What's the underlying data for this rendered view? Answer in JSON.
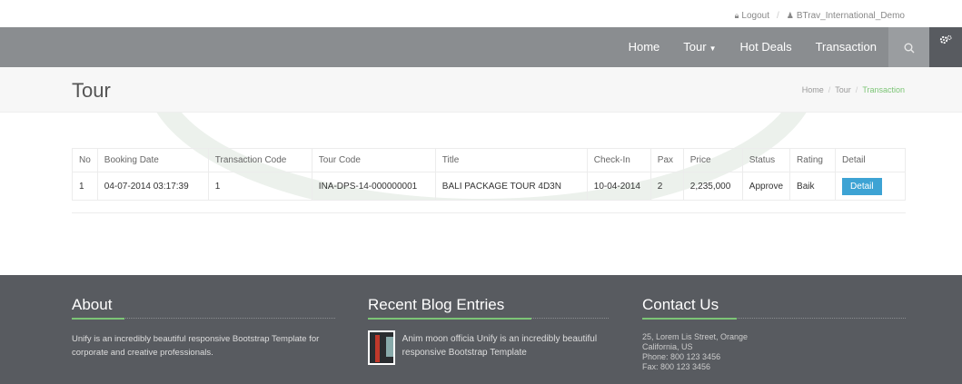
{
  "topbar": {
    "logout_label": "Logout",
    "user_label": "BTrav_International_Demo"
  },
  "nav": {
    "items": [
      {
        "label": "Home"
      },
      {
        "label": "Tour"
      },
      {
        "label": "Hot Deals"
      },
      {
        "label": "Transaction"
      }
    ]
  },
  "page": {
    "title": "Tour",
    "breadcrumb": [
      "Home",
      "Tour",
      "Transaction"
    ]
  },
  "table": {
    "headers": [
      "No",
      "Booking Date",
      "Transaction Code",
      "Tour Code",
      "Title",
      "Check-In",
      "Pax",
      "Price",
      "Status",
      "Rating",
      "Detail"
    ],
    "rows": [
      {
        "no": "1",
        "booking_date": "04-07-2014 03:17:39",
        "transaction_code": "1",
        "tour_code": "INA-DPS-14-000000001",
        "title": "BALI PACKAGE TOUR 4D3N",
        "check_in": "10-04-2014",
        "pax": "2",
        "price": "2,235,000",
        "status": "Approve",
        "rating": "Baik",
        "detail_label": "Detail"
      }
    ]
  },
  "footer": {
    "about": {
      "heading": "About",
      "text": "Unify is an incredibly beautiful responsive Bootstrap Template for corporate and creative professionals."
    },
    "blog": {
      "heading": "Recent Blog Entries",
      "entry_text": "Anim moon officia Unify is an incredibly beautiful responsive Bootstrap Template"
    },
    "contact": {
      "heading": "Contact Us",
      "lines": [
        "25, Lorem Lis Street, Orange",
        "California, US",
        "Phone: 800 123 3456",
        "Fax: 800 123 3456"
      ]
    }
  },
  "colors": {
    "nav_bg": "#8a8d90",
    "footer_bg": "#585b60",
    "accent_green": "#7cc576",
    "button_blue": "#3da3d4"
  }
}
